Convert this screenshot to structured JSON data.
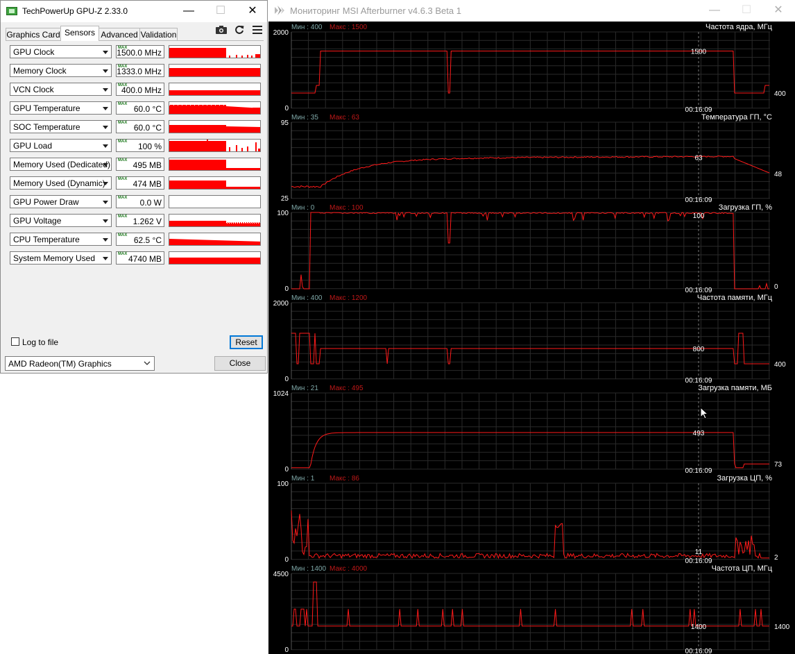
{
  "gpuz": {
    "title": "TechPowerUp GPU-Z 2.33.0",
    "window_buttons": {
      "minimize": "—",
      "maximize": "☐",
      "close": "✕"
    },
    "tabs": [
      {
        "label": "Graphics Card",
        "active": false
      },
      {
        "label": "Sensors",
        "active": true
      },
      {
        "label": "Advanced",
        "active": false
      },
      {
        "label": "Validation",
        "active": false
      }
    ],
    "tool_icons": [
      "camera-icon",
      "refresh-icon",
      "menu-icon"
    ],
    "sensors": [
      {
        "name": "GPU Clock",
        "max_tag": "MAX",
        "value": "1500.0 MHz",
        "graph": "gpuclock"
      },
      {
        "name": "Memory Clock",
        "max_tag": "MAX",
        "value": "1333.0 MHz",
        "graph": "full"
      },
      {
        "name": "VCN Clock",
        "max_tag": "MAX",
        "value": "400.0 MHz",
        "graph": "vcn"
      },
      {
        "name": "GPU Temperature",
        "max_tag": "MAX",
        "value": "60.0 °C",
        "graph": "temp"
      },
      {
        "name": "SOC Temperature",
        "max_tag": "MAX",
        "value": "60.0 °C",
        "graph": "soctemp"
      },
      {
        "name": "GPU Load",
        "max_tag": "MAX",
        "value": "100 %",
        "graph": "load"
      },
      {
        "name": "Memory Used (Dedicated)",
        "max_tag": "MAX",
        "value": "495 MB",
        "graph": "memded"
      },
      {
        "name": "Memory Used (Dynamic)",
        "max_tag": "MAX",
        "value": "474 MB",
        "graph": "memdyn"
      },
      {
        "name": "GPU Power Draw",
        "max_tag": "MAX",
        "value": "0.0 W",
        "graph": "none"
      },
      {
        "name": "GPU Voltage",
        "max_tag": "MAX",
        "value": "1.262 V",
        "graph": "volt"
      },
      {
        "name": "CPU Temperature",
        "max_tag": "MAX",
        "value": "62.5 °C",
        "graph": "cputemp"
      },
      {
        "name": "System Memory Used",
        "max_tag": "MAX",
        "value": "4740 MB",
        "graph": "sysmem"
      }
    ],
    "log_to_file": {
      "label": "Log to file",
      "checked": false
    },
    "reset_label": "Reset",
    "gpu_select": {
      "selected": "AMD Radeon(TM) Graphics"
    },
    "close_label": "Close",
    "graph_color": "#ff0000"
  },
  "afterburner": {
    "title": "Мониторинг MSI Afterburner v4.6.3 Beta 1",
    "window_buttons": {
      "minimize": "—",
      "maximize": "☐",
      "close": "✕"
    },
    "colors": {
      "line": "#ff1a1a",
      "grid": "#2a2a2a",
      "min_label": "#7fa8a8",
      "max_label": "#c01818",
      "text": "#ffffff",
      "cursor": "#7a7a7a"
    },
    "timestamp": "00:16:09",
    "panels": [
      {
        "name": "Частота ядра, МГц",
        "min_text": "Мин : 400",
        "max_text": "Макс : 1500",
        "axis_top": "2000",
        "axis_bottom": "0",
        "ymax": 2000,
        "cursor_value": "1500",
        "end_value": "400",
        "shape": "gpuclock"
      },
      {
        "name": "Температура ГП, °С",
        "min_text": "Мин : 35",
        "max_text": "Макс : 63",
        "axis_top": "95",
        "axis_bottom": "25",
        "ymin": 25,
        "ymax": 95,
        "cursor_value": "63",
        "end_value": "48",
        "shape": "temp"
      },
      {
        "name": "Загрузка ГП, %",
        "min_text": "Мин : 0",
        "max_text": "Макс : 100",
        "axis_top": "100",
        "axis_bottom": "0",
        "ymax": 100,
        "cursor_value": "100",
        "end_value": "0",
        "shape": "load"
      },
      {
        "name": "Частота памяти, МГц",
        "min_text": "Мин : 400",
        "max_text": "Макс : 1200",
        "axis_top": "2000",
        "axis_bottom": "0",
        "ymax": 2000,
        "cursor_value": "800",
        "end_value": "400",
        "shape": "memclock"
      },
      {
        "name": "Загрузка памяти, МБ",
        "min_text": "Мин : 21",
        "max_text": "Макс : 495",
        "axis_top": "1024",
        "axis_bottom": "0",
        "ymax": 1024,
        "cursor_value": "493",
        "end_value": "73",
        "shape": "memused"
      },
      {
        "name": "Загрузка ЦП, %",
        "min_text": "Мин : 1",
        "max_text": "Макс : 86",
        "axis_top": "100",
        "axis_bottom": "0",
        "ymax": 100,
        "cursor_value": "11",
        "end_value": "2",
        "shape": "cpuload"
      },
      {
        "name": "Частота ЦП, МГц",
        "min_text": "Мин : 1400",
        "max_text": "Макс : 4000",
        "axis_top": "4500",
        "axis_bottom": "0",
        "ymax": 4500,
        "cursor_value": "1400",
        "end_value": "1400",
        "shape": "cpuclock"
      }
    ]
  }
}
